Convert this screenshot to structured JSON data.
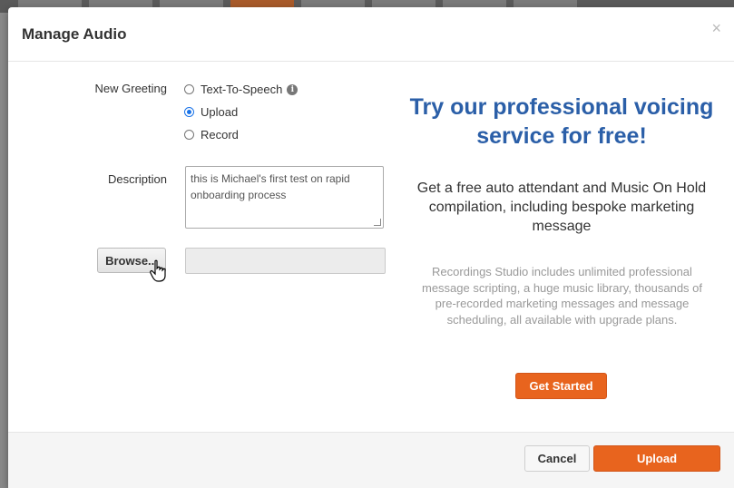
{
  "modal": {
    "title": "Manage Audio",
    "close_glyph": "×"
  },
  "form": {
    "new_greeting_label": "New Greeting",
    "options": [
      {
        "label": "Text-To-Speech",
        "checked": false,
        "info_icon": "info-icon"
      },
      {
        "label": "Upload",
        "checked": true
      },
      {
        "label": "Record",
        "checked": false
      }
    ],
    "description_label": "Description",
    "description_value": "this is Michael's first test on rapid onboarding process",
    "browse_label": "Browse...",
    "file_value": ""
  },
  "promo": {
    "headline": "Try our professional voicing service for free!",
    "subhead": "Get a free auto attendant and Music On Hold compilation, including bespoke marketing message",
    "details": "Recordings Studio includes unlimited professional message scripting, a huge music library, thousands of pre-recorded marketing messages and message scheduling, all available with upgrade plans.",
    "cta_label": "Get Started"
  },
  "footer": {
    "cancel_label": "Cancel",
    "upload_label": "Upload"
  },
  "colors": {
    "accent_orange": "#e8641e",
    "headline_blue": "#2b5fa8"
  }
}
